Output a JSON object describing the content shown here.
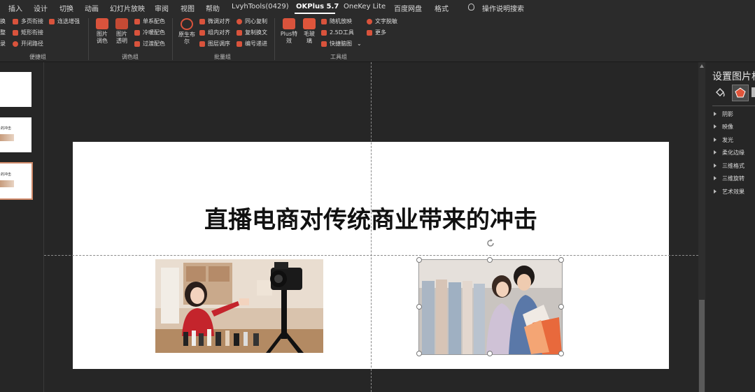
{
  "tabs": {
    "insert": "插入",
    "design": "设计",
    "transitions": "切换",
    "animations": "动画",
    "slideshow": "幻灯片放映",
    "review": "审阅",
    "view": "视图",
    "help": "帮助",
    "lvyhtools": "LvyhTools(0429)",
    "okplus": "OKPlus 5.7",
    "onekey": "OneKey Lite",
    "baidu": "百度网盘",
    "format": "格式",
    "tell_me": "操作说明搜索"
  },
  "ribbon": {
    "group1": {
      "col1": [
        "换",
        "整",
        "录"
      ],
      "col2": [
        "多页衔接",
        "矩形衔接",
        "开闭路径"
      ],
      "col3": [
        "连选增强"
      ],
      "label": "便捷组"
    },
    "group2": {
      "big1": "图片\n调色",
      "big2": "图片\n透明",
      "small": [
        "单系配色",
        "冷暖配色",
        "过渡配色"
      ],
      "label": "调色组"
    },
    "group3": {
      "big1": "原生布\n尔",
      "col1": [
        "微调对齐",
        "组内对齐",
        "图层调序"
      ],
      "col2": [
        "同心复制",
        "复制换文",
        "编号递进"
      ],
      "label": "批量组"
    },
    "group4": {
      "big1": "Plus特\n效",
      "big2": "毛玻\n璃",
      "col1": [
        "随机放映",
        "2.5D工具",
        "快捷脑图"
      ],
      "col2": [
        "文字脱敏",
        "更多"
      ],
      "label": "工具组"
    }
  },
  "thumbnails": [
    {
      "title": ""
    },
    {
      "title": "的冲击"
    },
    {
      "title": "的冲击"
    }
  ],
  "slide": {
    "title": "直播电商对传统商业带来的冲击"
  },
  "format_pane": {
    "title": "设置图片格",
    "items": [
      "阴影",
      "映像",
      "发光",
      "柔化边缘",
      "三维格式",
      "三维旋转",
      "艺术效果"
    ]
  }
}
